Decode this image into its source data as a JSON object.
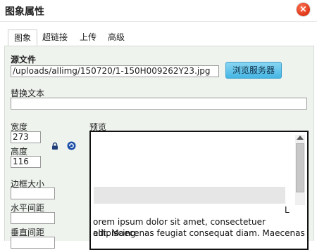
{
  "dialog": {
    "title": "图象属性",
    "close_glyph": "×"
  },
  "tabs": [
    {
      "label": "图象",
      "active": true
    },
    {
      "label": "超链接",
      "active": false
    },
    {
      "label": "上传",
      "active": false
    },
    {
      "label": "高级",
      "active": false
    }
  ],
  "form": {
    "source_label": "源文件",
    "source_value": "/uploads/allimg/150720/1-150H009262Y23.jpg",
    "browse_label": "浏览服务器",
    "alt_label": "替换文本",
    "alt_value": "",
    "width_label": "宽度",
    "width_value": "273",
    "height_label": "高度",
    "height_value": "116",
    "lock_icon": "lock-icon",
    "reset_icon": "reset-size-icon",
    "border_label": "边框大小",
    "border_value": "",
    "hspace_label": "水平间距",
    "hspace_value": "",
    "vspace_label": "垂直间距",
    "vspace_value": ""
  },
  "preview": {
    "label": "预览",
    "marker": "L",
    "text_line1": "orem ipsum dolor sit amet, consectetuer adipiscing",
    "text_line2": "elit. Maecenas feugiat consequat diam. Maecenas"
  },
  "colors": {
    "accent_button": "#45b6e4",
    "close_button": "#e33b1c",
    "panel_background": "#eef3ee"
  }
}
